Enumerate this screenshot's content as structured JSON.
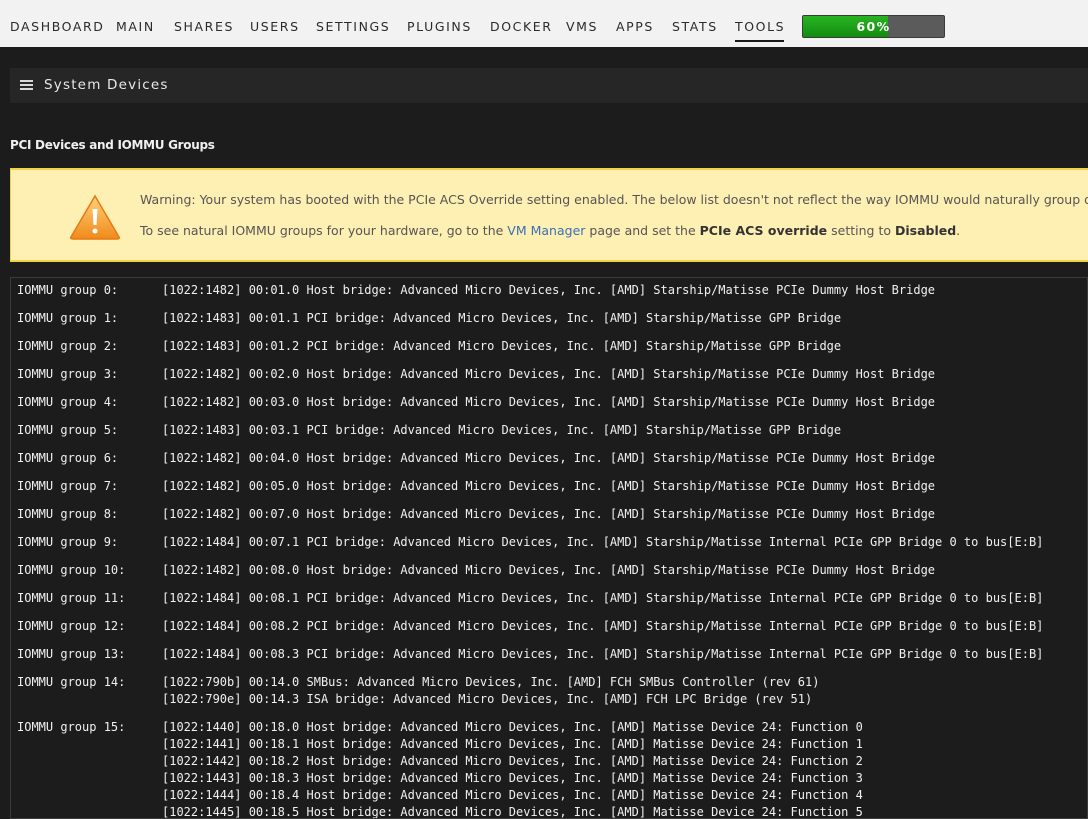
{
  "nav": {
    "items": [
      "DASHBOARD",
      "MAIN",
      "SHARES",
      "USERS",
      "SETTINGS",
      "PLUGINS",
      "DOCKER",
      "VMS",
      "APPS",
      "STATS",
      "TOOLS"
    ],
    "active": "TOOLS",
    "progress": {
      "label": "60%",
      "value": 0.6
    }
  },
  "header": {
    "title": "System Devices",
    "icon": "list-icon"
  },
  "subtitle": "PCI Devices and IOMMU Groups",
  "warning": {
    "icon": "warning-triangle-icon",
    "line1": "Warning: Your system has booted with the PCIe ACS Override setting enabled. The below list doesn't not reflect the way IOMMU would naturally group d",
    "line2_before": "To see natural IOMMU groups for your hardware, go to the ",
    "line2_link": "VM Manager",
    "line2_middle": " page and set the ",
    "line2_setting": "PCIe ACS override",
    "line2_after": " setting to ",
    "line2_value": "Disabled",
    "line2_end": "."
  },
  "iommu_groups": [
    {
      "label": "IOMMU group 0:",
      "devices": [
        "[1022:1482] 00:01.0 Host bridge: Advanced Micro Devices, Inc. [AMD] Starship/Matisse PCIe Dummy Host Bridge"
      ]
    },
    {
      "label": "IOMMU group 1:",
      "devices": [
        "[1022:1483] 00:01.1 PCI bridge: Advanced Micro Devices, Inc. [AMD] Starship/Matisse GPP Bridge"
      ]
    },
    {
      "label": "IOMMU group 2:",
      "devices": [
        "[1022:1483] 00:01.2 PCI bridge: Advanced Micro Devices, Inc. [AMD] Starship/Matisse GPP Bridge"
      ]
    },
    {
      "label": "IOMMU group 3:",
      "devices": [
        "[1022:1482] 00:02.0 Host bridge: Advanced Micro Devices, Inc. [AMD] Starship/Matisse PCIe Dummy Host Bridge"
      ]
    },
    {
      "label": "IOMMU group 4:",
      "devices": [
        "[1022:1482] 00:03.0 Host bridge: Advanced Micro Devices, Inc. [AMD] Starship/Matisse PCIe Dummy Host Bridge"
      ]
    },
    {
      "label": "IOMMU group 5:",
      "devices": [
        "[1022:1483] 00:03.1 PCI bridge: Advanced Micro Devices, Inc. [AMD] Starship/Matisse GPP Bridge"
      ]
    },
    {
      "label": "IOMMU group 6:",
      "devices": [
        "[1022:1482] 00:04.0 Host bridge: Advanced Micro Devices, Inc. [AMD] Starship/Matisse PCIe Dummy Host Bridge"
      ]
    },
    {
      "label": "IOMMU group 7:",
      "devices": [
        "[1022:1482] 00:05.0 Host bridge: Advanced Micro Devices, Inc. [AMD] Starship/Matisse PCIe Dummy Host Bridge"
      ]
    },
    {
      "label": "IOMMU group 8:",
      "devices": [
        "[1022:1482] 00:07.0 Host bridge: Advanced Micro Devices, Inc. [AMD] Starship/Matisse PCIe Dummy Host Bridge"
      ]
    },
    {
      "label": "IOMMU group 9:",
      "devices": [
        "[1022:1484] 00:07.1 PCI bridge: Advanced Micro Devices, Inc. [AMD] Starship/Matisse Internal PCIe GPP Bridge 0 to bus[E:B]"
      ]
    },
    {
      "label": "IOMMU group 10:",
      "devices": [
        "[1022:1482] 00:08.0 Host bridge: Advanced Micro Devices, Inc. [AMD] Starship/Matisse PCIe Dummy Host Bridge"
      ]
    },
    {
      "label": "IOMMU group 11:",
      "devices": [
        "[1022:1484] 00:08.1 PCI bridge: Advanced Micro Devices, Inc. [AMD] Starship/Matisse Internal PCIe GPP Bridge 0 to bus[E:B]"
      ]
    },
    {
      "label": "IOMMU group 12:",
      "devices": [
        "[1022:1484] 00:08.2 PCI bridge: Advanced Micro Devices, Inc. [AMD] Starship/Matisse Internal PCIe GPP Bridge 0 to bus[E:B]"
      ]
    },
    {
      "label": "IOMMU group 13:",
      "devices": [
        "[1022:1484] 00:08.3 PCI bridge: Advanced Micro Devices, Inc. [AMD] Starship/Matisse Internal PCIe GPP Bridge 0 to bus[E:B]"
      ]
    },
    {
      "label": "IOMMU group 14:",
      "devices": [
        "[1022:790b] 00:14.0 SMBus: Advanced Micro Devices, Inc. [AMD] FCH SMBus Controller (rev 61)",
        "[1022:790e] 00:14.3 ISA bridge: Advanced Micro Devices, Inc. [AMD] FCH LPC Bridge (rev 51)"
      ]
    },
    {
      "label": "IOMMU group 15:",
      "devices": [
        "[1022:1440] 00:18.0 Host bridge: Advanced Micro Devices, Inc. [AMD] Matisse Device 24: Function 0",
        "[1022:1441] 00:18.1 Host bridge: Advanced Micro Devices, Inc. [AMD] Matisse Device 24: Function 1",
        "[1022:1442] 00:18.2 Host bridge: Advanced Micro Devices, Inc. [AMD] Matisse Device 24: Function 2",
        "[1022:1443] 00:18.3 Host bridge: Advanced Micro Devices, Inc. [AMD] Matisse Device 24: Function 3",
        "[1022:1444] 00:18.4 Host bridge: Advanced Micro Devices, Inc. [AMD] Matisse Device 24: Function 4",
        "[1022:1445] 00:18.5 Host bridge: Advanced Micro Devices, Inc. [AMD] Matisse Device 24: Function 5"
      ]
    }
  ]
}
